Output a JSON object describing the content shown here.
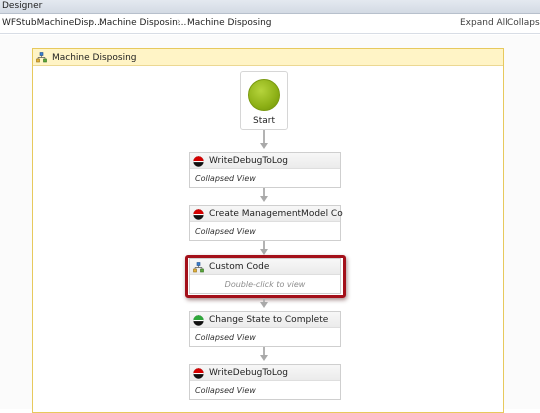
{
  "window": {
    "title": "Designer"
  },
  "breadcrumb": {
    "items": [
      "WFStubMachineDisp...",
      "Machine  Disposin...",
      "Machine Disposing"
    ],
    "separator": "›"
  },
  "header_actions": {
    "expand_all": "Expand All",
    "collapse_all": "Collapse A..."
  },
  "sequence": {
    "title": "Machine Disposing",
    "icon": "sequence-icon"
  },
  "start": {
    "label": "Start"
  },
  "activities": [
    {
      "title": "WriteDebugToLog",
      "body": "Collapsed View",
      "icon": "red-black-ball-icon"
    },
    {
      "title": "Create ManagementModel Co",
      "body": "Collapsed View",
      "icon": "red-black-ball-icon"
    },
    {
      "title": "Custom Code",
      "body": "Double-click to view",
      "icon": "sequence-icon"
    },
    {
      "title": "Change State to Complete",
      "body": "Collapsed View",
      "icon": "green-black-ball-icon"
    },
    {
      "title": "WriteDebugToLog",
      "body": "Collapsed View",
      "icon": "red-black-ball-icon"
    }
  ],
  "colors": {
    "highlight": "#a3101a",
    "sequence_header": "#fff4c6",
    "start_green": "#8db016",
    "activity_red": "#d40000",
    "activity_green": "#2ea83a"
  }
}
